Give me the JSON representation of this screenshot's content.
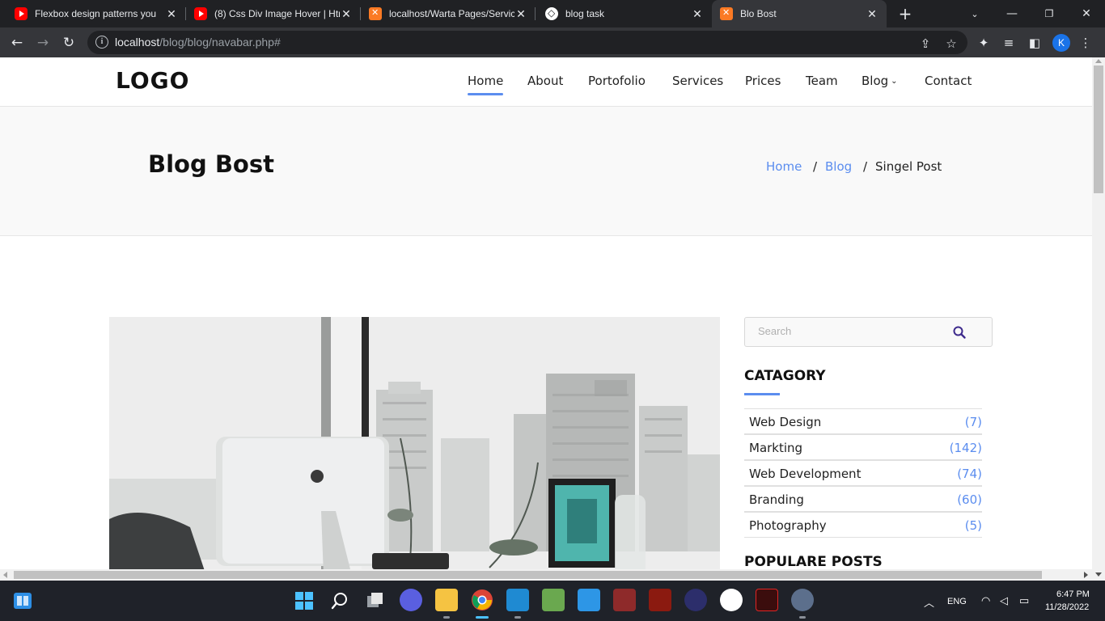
{
  "browser": {
    "tabs": [
      {
        "title": "Flexbox design patterns you",
        "icon": "youtube-icon"
      },
      {
        "title": "(8) Css Div Image Hover | Htn",
        "icon": "youtube-icon"
      },
      {
        "title": "localhost/Warta Pages/Servic",
        "icon": "xampp-icon"
      },
      {
        "title": "blog task",
        "icon": "codepen-icon"
      },
      {
        "title": "Blo Bost",
        "icon": "xampp-icon"
      }
    ],
    "close_glyph": "✕",
    "url_host": "localhost",
    "url_path": "/blog/blog/navabar.php#",
    "profile_initial": "K"
  },
  "site": {
    "logo": "LOGO",
    "nav": [
      "Home",
      "About",
      "Portofolio",
      "Services",
      "Prices",
      "Team",
      "Blog",
      "Contact"
    ],
    "active_nav": "Home",
    "accent": "#5b8def"
  },
  "hero": {
    "title": "Blog Bost",
    "breadcrumb": [
      "Home",
      "Blog",
      "Singel Post"
    ],
    "separator": "/"
  },
  "sidebar": {
    "search_placeholder": "Search",
    "category_heading": "CATAGORY",
    "categories": [
      {
        "name": "Web Design",
        "count": "(7)"
      },
      {
        "name": "Markting",
        "count": "(142)"
      },
      {
        "name": "Web Development",
        "count": "(74)"
      },
      {
        "name": "Branding",
        "count": "(60)"
      },
      {
        "name": "Photography",
        "count": "(5)"
      }
    ],
    "popular_heading": "POPULARE POSTS"
  },
  "taskbar": {
    "lang": "ENG",
    "time": "6:47 PM",
    "date": "11/28/2022"
  }
}
